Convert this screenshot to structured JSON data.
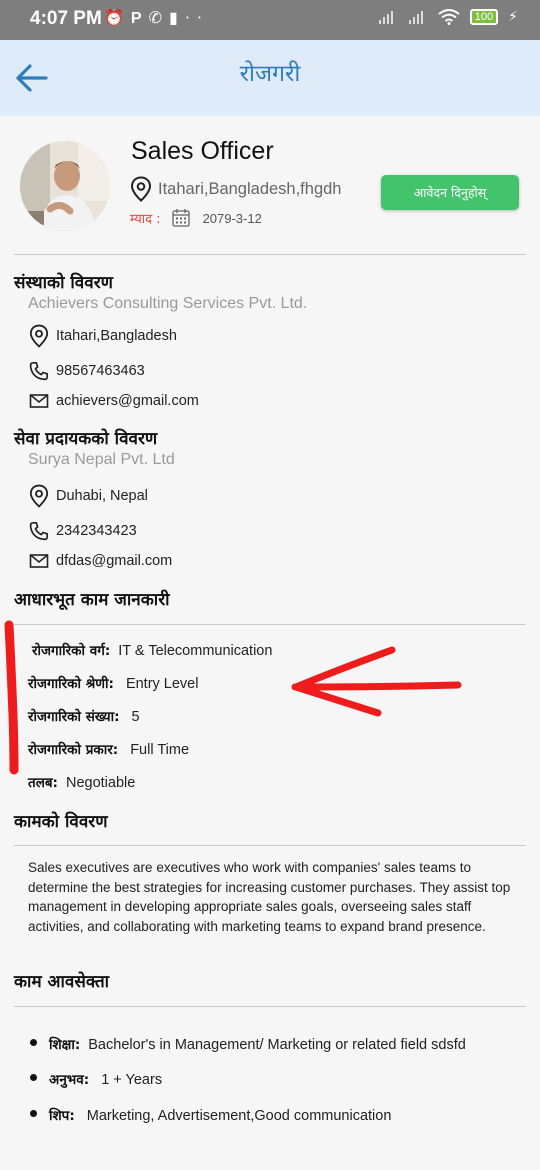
{
  "status_bar": {
    "time": "4:07 PM",
    "battery": "100",
    "left_icons": [
      "alarm-icon",
      "p-icon",
      "whatsapp-icon",
      "trash-icon",
      "more-dots-icon"
    ],
    "right_icons": [
      "signal-icon",
      "signal-icon",
      "wifi-icon",
      "battery-icon",
      "charging-icon"
    ]
  },
  "app_bar": {
    "title": "रोजगरी",
    "back_icon": "arrow-left-icon"
  },
  "job": {
    "title": "Sales Officer",
    "location": "Itahari,Bangladesh,fhgdh",
    "deadline_label": "म्याद :",
    "deadline_date": "2079-3-12",
    "apply_label": "आवेदन दिनुहोस्"
  },
  "organization": {
    "heading": "संस्थाको विवरण",
    "name": "Achievers Consulting Services Pvt. Ltd.",
    "address": "Itahari,Bangladesh",
    "phone": "98567463463",
    "email": "achievers@gmail.com"
  },
  "provider": {
    "heading": "सेवा प्रदायकको विवरण",
    "name": "Surya Nepal Pvt. Ltd",
    "address": "Duhabi, Nepal",
    "phone": "2342343423",
    "email": "dfdas@gmail.com"
  },
  "basic_info": {
    "heading": "आधारभूत काम जानकारी",
    "items": [
      {
        "key": "रोजगारिको वर्ग:",
        "value": "IT & Telecommunication"
      },
      {
        "key": "रोजगारिको श्रेणी:",
        "value": "Entry Level"
      },
      {
        "key": "रोजगारिको संख्या:",
        "value": "5"
      },
      {
        "key": "रोजगारिको प्रकार:",
        "value": "Full Time"
      },
      {
        "key": "तलब:",
        "value": "Negotiable"
      }
    ]
  },
  "description": {
    "heading": "कामको विवरण",
    "text": "Sales executives are executives who work with companies' sales teams to determine the best strategies for increasing customer purchases. They assist top management in developing appropriate sales goals, overseeing sales staff activities, and collaborating with marketing teams to expand brand presence."
  },
  "requirements": {
    "heading": "काम आवसेक्ता",
    "items": [
      {
        "key": "शिक्षा:",
        "value": "Bachelor's in Management/ Marketing or related field sdsfd"
      },
      {
        "key": "अनुभव:",
        "value": "1 + Years"
      },
      {
        "key": "शिप:",
        "value": "Marketing, Advertisement,Good communication"
      }
    ]
  },
  "colors": {
    "app_bar_bg": "#dfebf8",
    "title_blue": "#2f7dbb",
    "apply_green": "#43c36b",
    "deadline_red": "#e44444",
    "annotation_red": "#ee1c1c"
  }
}
